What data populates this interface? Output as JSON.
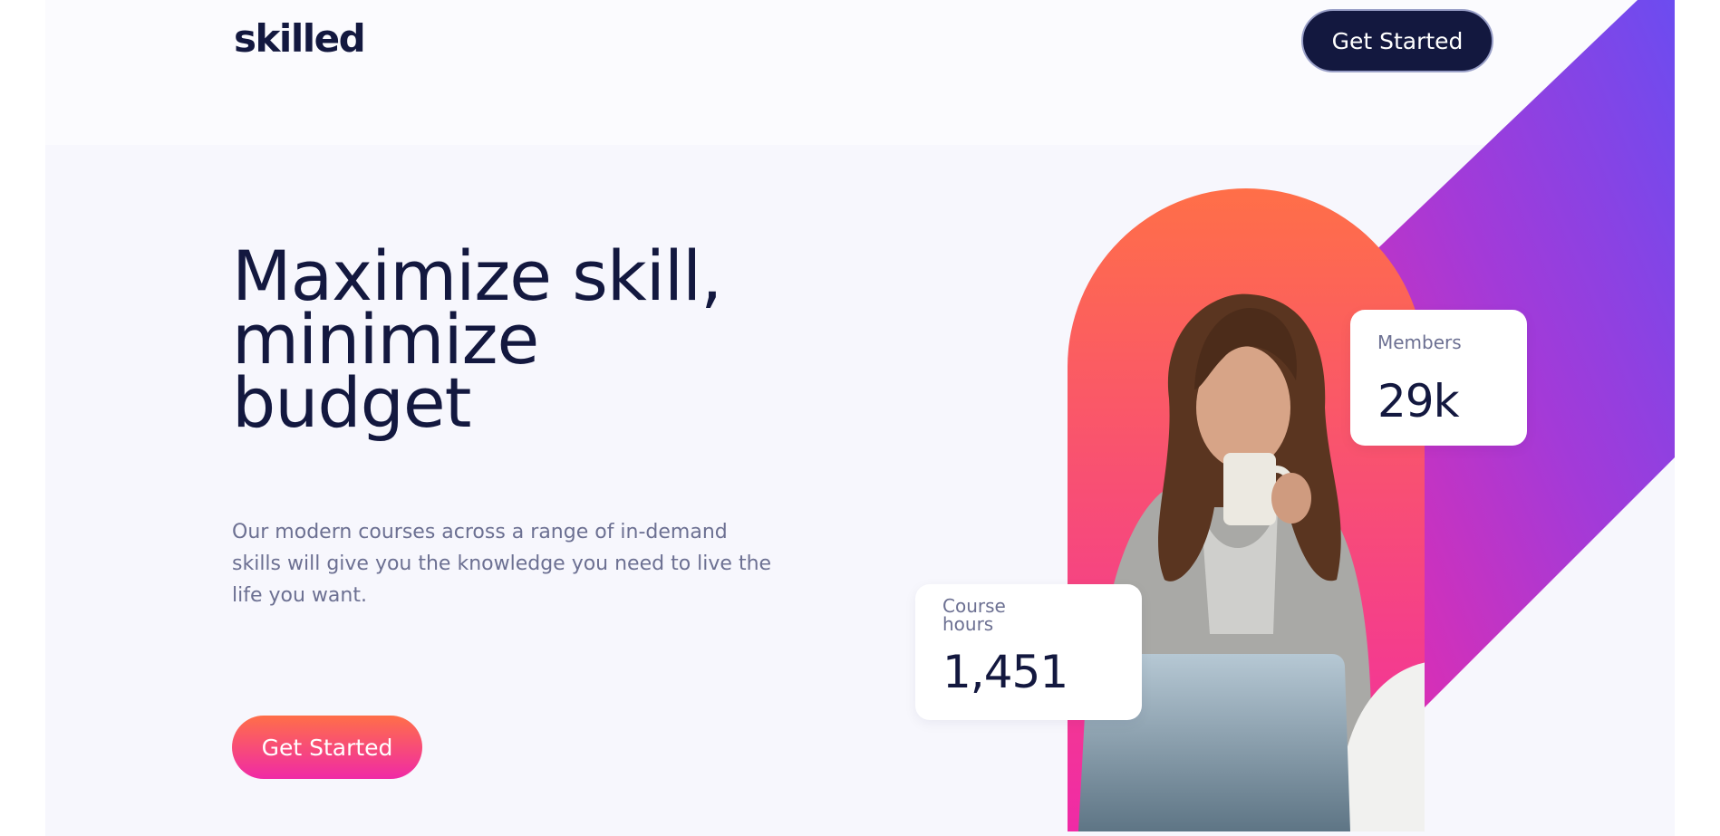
{
  "header": {
    "logo": "skilled",
    "cta_label": "Get Started"
  },
  "hero": {
    "headline_lines": [
      "Maximize skill,",
      "minimize",
      "budget"
    ],
    "description": "Our modern courses across a range of in-demand skills will give you the knowledge you need to live the life you want.",
    "cta_label": "Get Started"
  },
  "stats": {
    "members": {
      "label": "Members",
      "value": "29k"
    },
    "hours": {
      "label": "Course hours",
      "value": "1,451"
    }
  },
  "colors": {
    "navy": "#13183f",
    "gradient_orange": "#ff6f48",
    "gradient_pink": "#f02aa6",
    "gradient_purple": "#6c4cf0",
    "muted_text": "#6c7092"
  },
  "icons": {
    "hero_image": "woman-drinking-coffee-illustration"
  }
}
